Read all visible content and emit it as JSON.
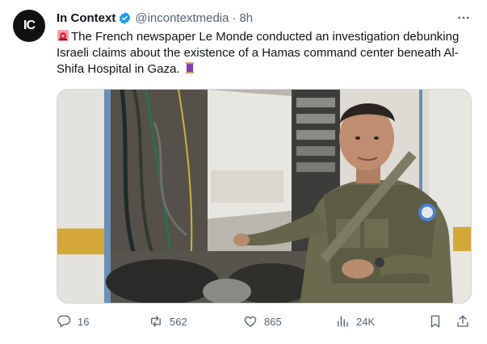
{
  "author": {
    "name": "In Context",
    "handle": "@incontextmedia",
    "separator": "·",
    "time": "8h",
    "avatar_text": "IC"
  },
  "tweet": {
    "text": "The French newspaper Le Monde conducted an investigation debunking Israeli claims about the existence of a Hamas command center beneath Al-Shifa Hospital in Gaza.",
    "leading_emoji": "siren-emoji",
    "trailing_emoji": "thread-spool-emoji"
  },
  "media": {
    "description_icon": "photo"
  },
  "actions": {
    "replies": "16",
    "reposts": "562",
    "likes": "865",
    "views": "24K"
  },
  "colors": {
    "text": "#0f1419",
    "muted": "#536471",
    "verified": "#1d9bf0",
    "avatar_bg": "#111111",
    "avatar_accent": "#e0242f"
  },
  "icons": {
    "more": "more-icon",
    "reply": "reply-icon",
    "repost": "repost-icon",
    "like": "like-icon",
    "views": "views-icon",
    "bookmark": "bookmark-icon",
    "share": "share-icon"
  }
}
